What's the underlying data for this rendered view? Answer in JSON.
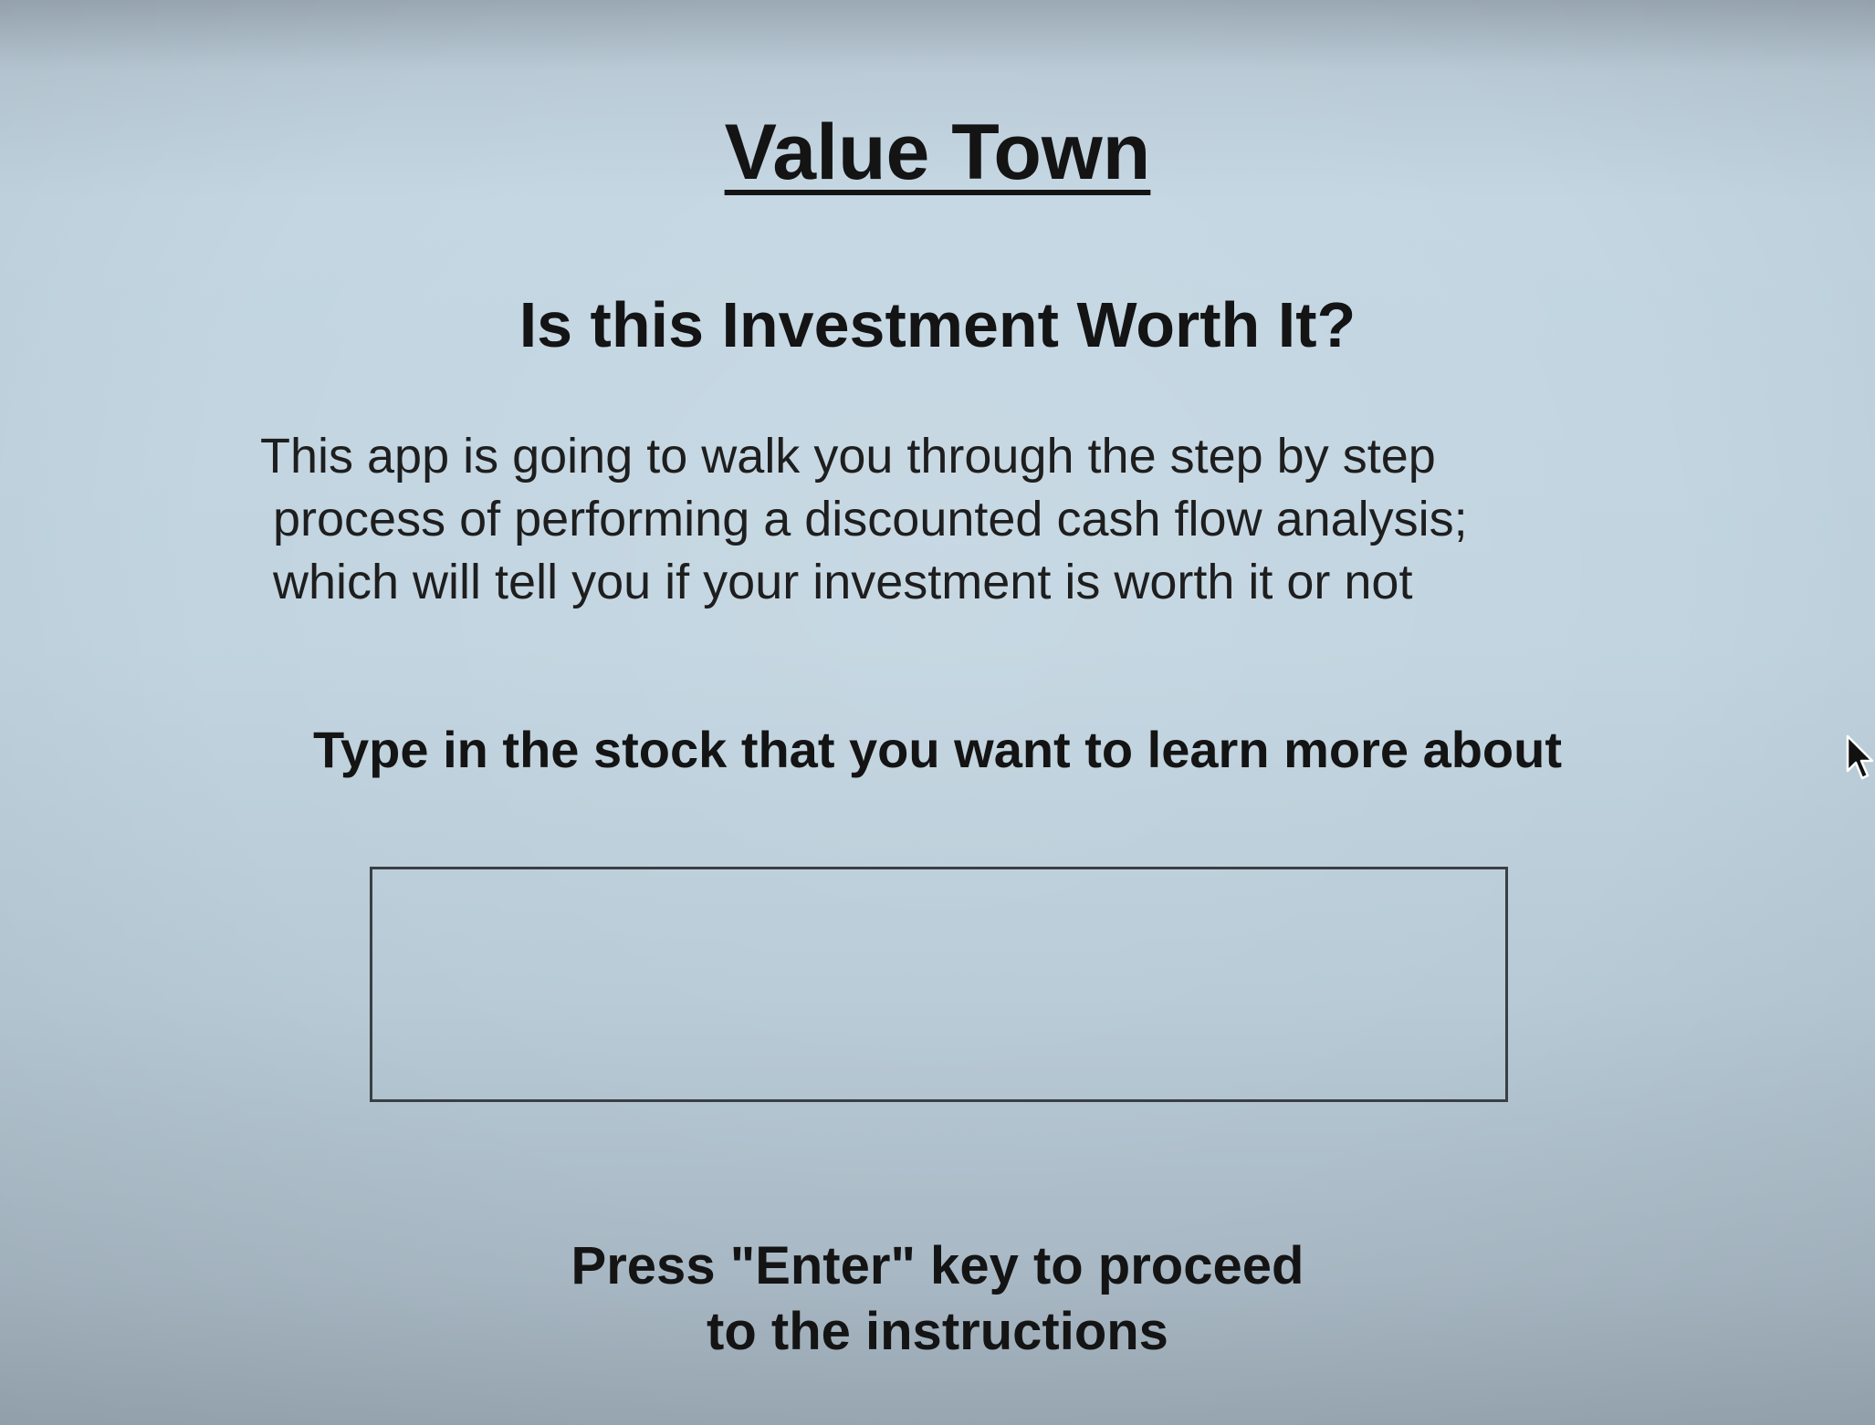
{
  "app": {
    "title": "Value Town",
    "subtitle": "Is this Investment Worth It?",
    "description_lines": [
      "This app is going to walk you through the step by step",
      "process of performing a discounted cash flow analysis;",
      "which will tell you if your investment is worth it or not"
    ],
    "prompt": "Type in the stock that you want to learn more about",
    "stock_input": {
      "value": "",
      "placeholder": ""
    },
    "instructions_lines": [
      "Press \"Enter\" key to proceed",
      "to the instructions"
    ]
  },
  "icons": {
    "cursor": "mouse-pointer-icon"
  },
  "colors": {
    "background": "#c1d4e0",
    "text": "#141414",
    "input_border": "#3a3f44"
  }
}
